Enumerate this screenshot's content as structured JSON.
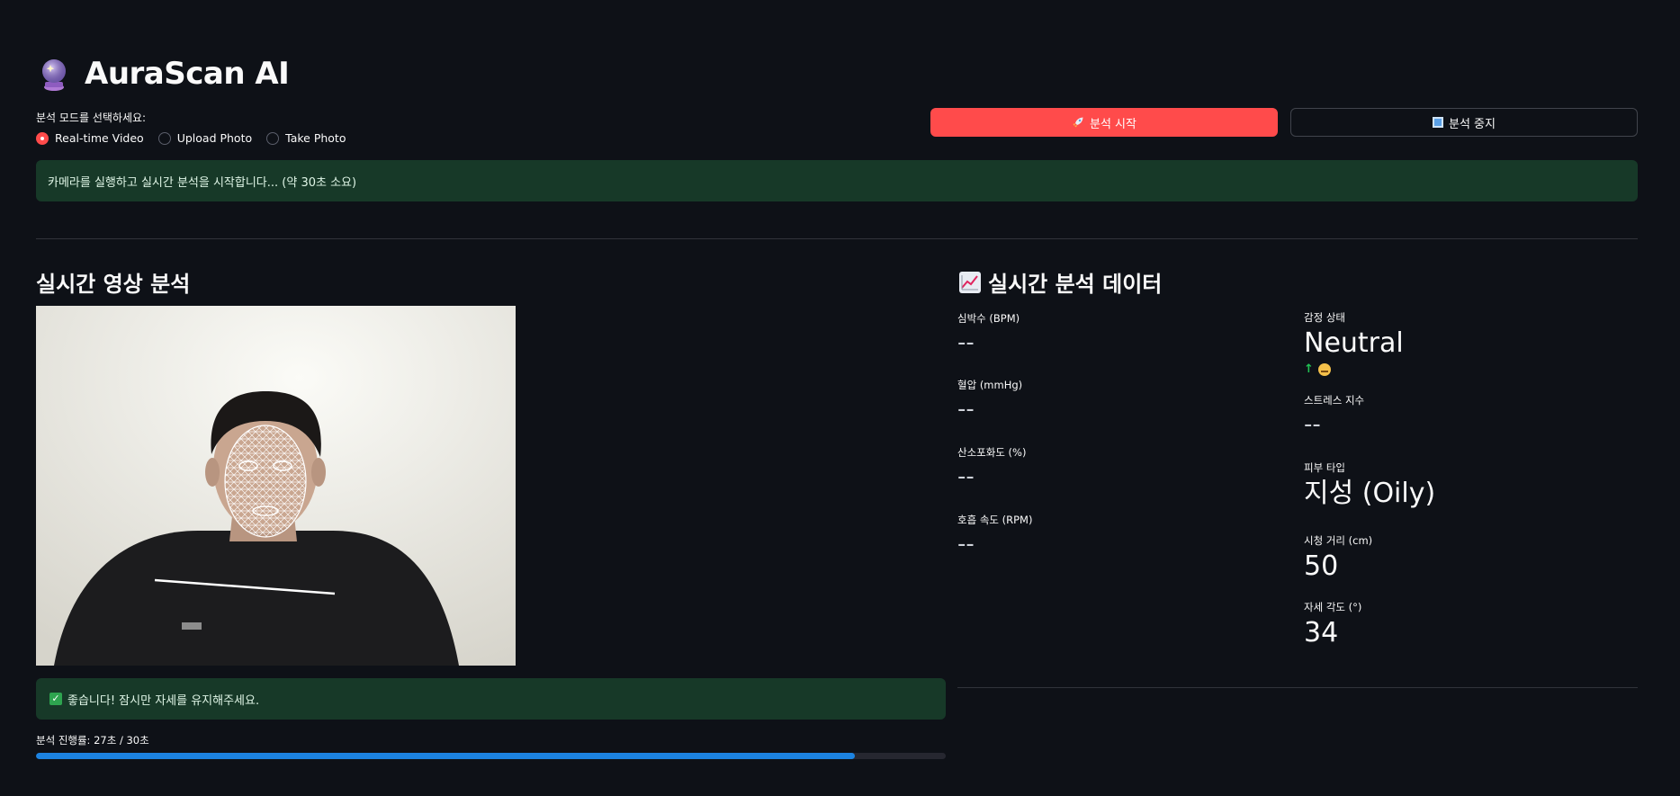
{
  "app": {
    "title": "AuraScan AI",
    "title_icon": "crystal-ball-icon"
  },
  "mode": {
    "label": "분석 모드를 선택하세요:",
    "options": [
      "Real-time Video",
      "Upload Photo",
      "Take Photo"
    ],
    "selected": "Real-time Video"
  },
  "buttons": {
    "start_label": "분석 시작",
    "start_icon": "rocket-icon",
    "stop_label": "분석 중지",
    "stop_icon": "stop-square-icon"
  },
  "info_banner": "카메라를 실행하고 실시간 분석을 시작합니다... (약 30초 소요)",
  "video_section": {
    "title": "실시간 영상 분석"
  },
  "data_section": {
    "title": "실시간 분석 데이터",
    "icon": "chart-increasing-icon"
  },
  "success_banner": "좋습니다! 잠시만 자세를 유지해주세요.",
  "progress": {
    "label": "분석 진행률: 27초 / 30초",
    "fraction": 0.9
  },
  "metrics_left": [
    {
      "label": "심박수 (BPM)",
      "value": "--"
    },
    {
      "label": "혈압 (mmHg)",
      "value": "--"
    },
    {
      "label": "산소포화도 (%)",
      "value": "--"
    },
    {
      "label": "호흡 속도 (RPM)",
      "value": "--"
    }
  ],
  "metrics_right": {
    "emotion": {
      "label": "감정 상태",
      "value": "Neutral",
      "delta_emoji": "grimacing-face-icon"
    },
    "stress": {
      "label": "스트레스 지수",
      "value": "--"
    },
    "skin": {
      "label": "피부 타입",
      "value": "지성 (Oily)"
    },
    "distance": {
      "label": "시청 거리 (cm)",
      "value": "50"
    },
    "posture": {
      "label": "자세 각도 (°)",
      "value": "34"
    }
  },
  "colors": {
    "background": "#0e1117",
    "accent": "#ff4b4b",
    "success_bg": "#173928",
    "progress": "#1c83e1"
  }
}
